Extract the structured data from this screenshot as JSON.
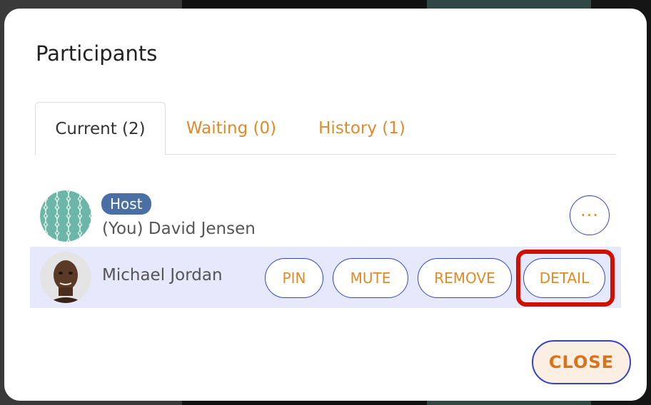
{
  "dialog": {
    "title": "Participants"
  },
  "tabs": [
    {
      "label": "Current (2)",
      "active": true
    },
    {
      "label": "Waiting (0)",
      "active": false
    },
    {
      "label": "History (1)",
      "active": false
    }
  ],
  "participants": [
    {
      "badge": "Host",
      "name": "(You) David Jensen",
      "avatar": "pattern-avatar",
      "more_label": "···"
    },
    {
      "name": "Michael Jordan",
      "avatar": "photo-avatar",
      "actions": {
        "pin": "PIN",
        "mute": "MUTE",
        "remove": "REMOVE",
        "detail": "DETAIL"
      }
    }
  ],
  "footer": {
    "close_label": "CLOSE"
  },
  "colors": {
    "accent": "#e08a2a",
    "border": "#3344cc",
    "selected_row": "#e6e9fb",
    "host_badge": "#4a6fa5",
    "highlight": "#cc1100"
  }
}
